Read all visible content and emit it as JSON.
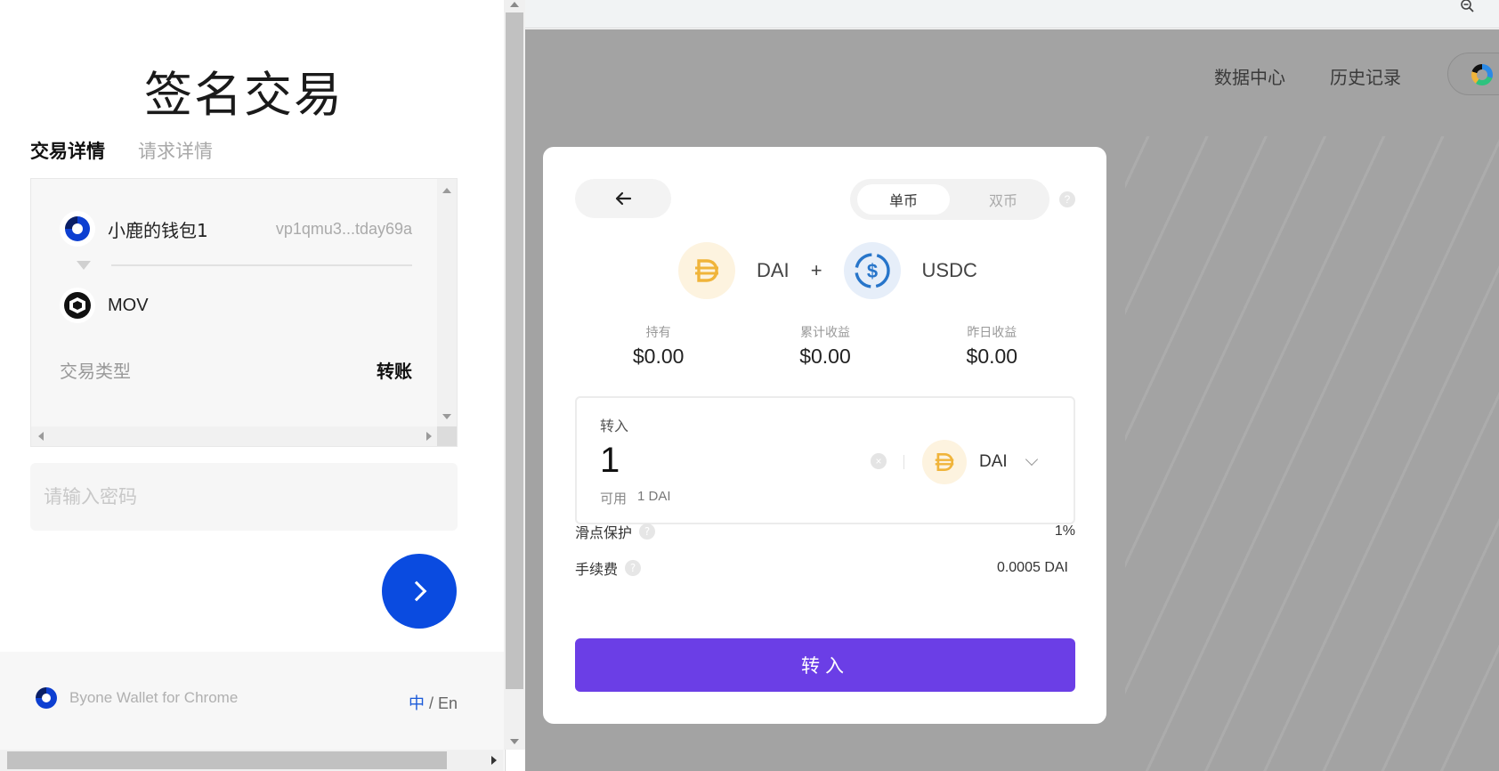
{
  "wallet_popup": {
    "title": "签名交易",
    "tabs": [
      {
        "label": "交易详情",
        "active": true
      },
      {
        "label": "请求详情",
        "active": false
      }
    ],
    "from": {
      "name": "小鹿的钱包1",
      "address": "vp1qmu3...tday69a"
    },
    "to": {
      "token": "MOV"
    },
    "tx_type": {
      "label": "交易类型",
      "value": "转账"
    },
    "password_placeholder": "请输入密码",
    "footer": {
      "brand": "Byone Wallet for Chrome",
      "lang_zh": "中",
      "lang_sep": " / ",
      "lang_en": "En"
    }
  },
  "dapp": {
    "nav": {
      "data_center": "数据中心",
      "history": "历史记录"
    },
    "mode": {
      "single": "单币",
      "double": "双币",
      "selected": "单币"
    },
    "pair": {
      "token_a": "DAI",
      "plus": "+",
      "token_b": "USDC"
    },
    "stats": [
      {
        "label": "持有",
        "value": "$0.00"
      },
      {
        "label": "累计收益",
        "value": "$0.00"
      },
      {
        "label": "昨日收益",
        "value": "$0.00"
      }
    ],
    "deposit": {
      "label": "转入",
      "amount": "1",
      "available_label": "可用",
      "available_value": "1 DAI",
      "token": "DAI"
    },
    "slippage": {
      "label": "滑点保护",
      "value": "1%"
    },
    "fee": {
      "label": "手续费",
      "value": "0.0005 DAI"
    },
    "submit_label": "转入"
  },
  "colors": {
    "wallet_accent": "#0a4be0",
    "submit": "#6b3ee6",
    "dai": "#f0b43a",
    "usdc": "#2775ca"
  }
}
